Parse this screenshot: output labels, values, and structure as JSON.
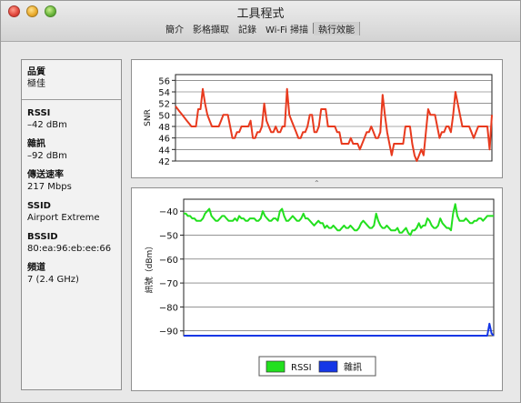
{
  "window": {
    "title": "工具程式"
  },
  "menu": {
    "items": [
      {
        "label": "簡介",
        "active": false
      },
      {
        "label": "影格擷取",
        "active": false
      },
      {
        "label": "記錄",
        "active": false
      },
      {
        "label": "Wi-Fi 掃描",
        "active": false
      },
      {
        "label": "執行效能",
        "active": true
      }
    ]
  },
  "sidebar": {
    "quality_label": "品質",
    "quality_value": "極佳",
    "stats": [
      {
        "label": "RSSI",
        "value": "–42 dBm"
      },
      {
        "label": "雜訊",
        "value": "–92 dBm"
      },
      {
        "label": "傳送速率",
        "value": "217 Mbps"
      },
      {
        "label": "SSID",
        "value": "Airport Extreme"
      },
      {
        "label": "BSSID",
        "value": "80:ea:96:eb:ee:66"
      },
      {
        "label": "頻道",
        "value": "7 (2.4 GHz)"
      }
    ]
  },
  "colors": {
    "snr": "#e83a1e",
    "rssi": "#22e01e",
    "noise": "#1436e6"
  },
  "chart_data": [
    {
      "type": "line",
      "ylabel": "SNR",
      "ylim": [
        42,
        57
      ],
      "yticks": [
        42,
        44,
        46,
        48,
        50,
        52,
        54,
        56
      ],
      "series": [
        {
          "values": [
            51.5,
            51,
            50.5,
            50,
            49.5,
            49,
            48.5,
            48,
            48,
            48,
            51,
            51,
            54.5,
            52,
            50,
            49,
            48,
            48,
            48,
            48,
            49,
            50,
            50,
            50,
            48,
            46,
            46,
            47,
            47,
            48,
            48,
            48,
            48,
            49,
            46,
            46,
            47,
            47,
            48,
            52,
            49,
            48,
            47,
            47,
            48,
            47,
            47,
            48,
            48,
            54.5,
            50,
            49,
            48,
            47,
            46,
            46,
            47,
            47,
            48,
            50,
            50,
            47,
            47,
            48,
            51,
            51,
            51,
            48,
            48,
            48,
            48,
            47,
            47,
            45,
            45,
            45,
            45,
            46,
            45,
            45,
            45,
            44,
            45,
            46,
            47,
            47,
            48,
            47,
            46,
            46,
            47,
            53.5,
            50,
            47,
            45,
            43,
            45,
            45,
            45,
            45,
            45,
            48,
            48,
            48,
            45,
            43,
            42,
            43,
            44,
            43,
            47,
            51,
            50,
            50,
            50,
            48,
            46,
            47,
            47,
            48,
            48,
            47,
            50,
            54,
            52,
            50,
            48,
            48,
            48,
            48,
            47,
            46,
            47,
            48,
            48,
            48,
            48,
            48,
            44,
            50
          ]
        }
      ]
    },
    {
      "type": "line",
      "ylabel": "訊號（dBm）",
      "ylim": [
        -92,
        -35
      ],
      "yticks": [
        -40,
        -50,
        -60,
        -70,
        -80,
        -90
      ],
      "legend_position": "bottom",
      "series": [
        {
          "name": "RSSI",
          "values": [
            -41,
            -41,
            -42,
            -42,
            -43,
            -43,
            -44,
            -44,
            -44,
            -43,
            -41,
            -40,
            -39,
            -42,
            -43,
            -44,
            -44,
            -43,
            -42,
            -42,
            -43,
            -44,
            -44,
            -44,
            -43,
            -44,
            -42,
            -43,
            -43,
            -44,
            -44,
            -43,
            -43,
            -43,
            -44,
            -44,
            -43,
            -40,
            -42,
            -43,
            -44,
            -44,
            -43,
            -43,
            -44,
            -40,
            -39,
            -42,
            -44,
            -44,
            -43,
            -42,
            -43,
            -44,
            -44,
            -43,
            -41,
            -43,
            -43,
            -44,
            -45,
            -46,
            -45,
            -44,
            -45,
            -45,
            -47,
            -46,
            -47,
            -47,
            -46,
            -47,
            -48,
            -48,
            -47,
            -46,
            -47,
            -47,
            -46,
            -47,
            -48,
            -48,
            -47,
            -45,
            -44,
            -45,
            -46,
            -47,
            -47,
            -46,
            -41,
            -44,
            -46,
            -47,
            -47,
            -46,
            -47,
            -48,
            -48,
            -48,
            -47,
            -49,
            -49,
            -48,
            -47,
            -49,
            -50,
            -48,
            -48,
            -47,
            -45,
            -47,
            -46,
            -46,
            -43,
            -44,
            -46,
            -47,
            -47,
            -46,
            -43,
            -45,
            -46,
            -47,
            -47,
            -48,
            -41,
            -37,
            -42,
            -44,
            -44,
            -44,
            -43,
            -44,
            -45,
            -45,
            -44,
            -44,
            -43,
            -43,
            -44,
            -43,
            -42,
            -42,
            -42,
            -42
          ]
        },
        {
          "name": "雜訊",
          "values": [
            -92,
            -92,
            -92,
            -92,
            -92,
            -92,
            -92,
            -92,
            -92,
            -92,
            -92,
            -92,
            -92,
            -92,
            -92,
            -92,
            -92,
            -92,
            -92,
            -92,
            -92,
            -92,
            -92,
            -92,
            -92,
            -92,
            -92,
            -92,
            -92,
            -92,
            -92,
            -92,
            -92,
            -92,
            -92,
            -92,
            -92,
            -92,
            -92,
            -92,
            -92,
            -92,
            -92,
            -92,
            -92,
            -92,
            -92,
            -92,
            -92,
            -92,
            -92,
            -92,
            -92,
            -92,
            -92,
            -92,
            -92,
            -92,
            -92,
            -92,
            -92,
            -92,
            -92,
            -92,
            -92,
            -92,
            -92,
            -92,
            -92,
            -92,
            -92,
            -92,
            -92,
            -92,
            -92,
            -92,
            -92,
            -92,
            -92,
            -92,
            -92,
            -92,
            -92,
            -92,
            -92,
            -92,
            -92,
            -92,
            -92,
            -92,
            -92,
            -92,
            -92,
            -92,
            -92,
            -92,
            -92,
            -92,
            -92,
            -92,
            -92,
            -92,
            -92,
            -92,
            -92,
            -92,
            -92,
            -92,
            -92,
            -92,
            -92,
            -92,
            -92,
            -92,
            -92,
            -92,
            -92,
            -92,
            -92,
            -92,
            -92,
            -92,
            -92,
            -92,
            -92,
            -92,
            -92,
            -92,
            -92,
            -92,
            -92,
            -92,
            -92,
            -92,
            -92,
            -92,
            -92,
            -92,
            -92,
            -92,
            -92,
            -92,
            -92,
            -87,
            -91,
            -92
          ]
        }
      ]
    }
  ]
}
